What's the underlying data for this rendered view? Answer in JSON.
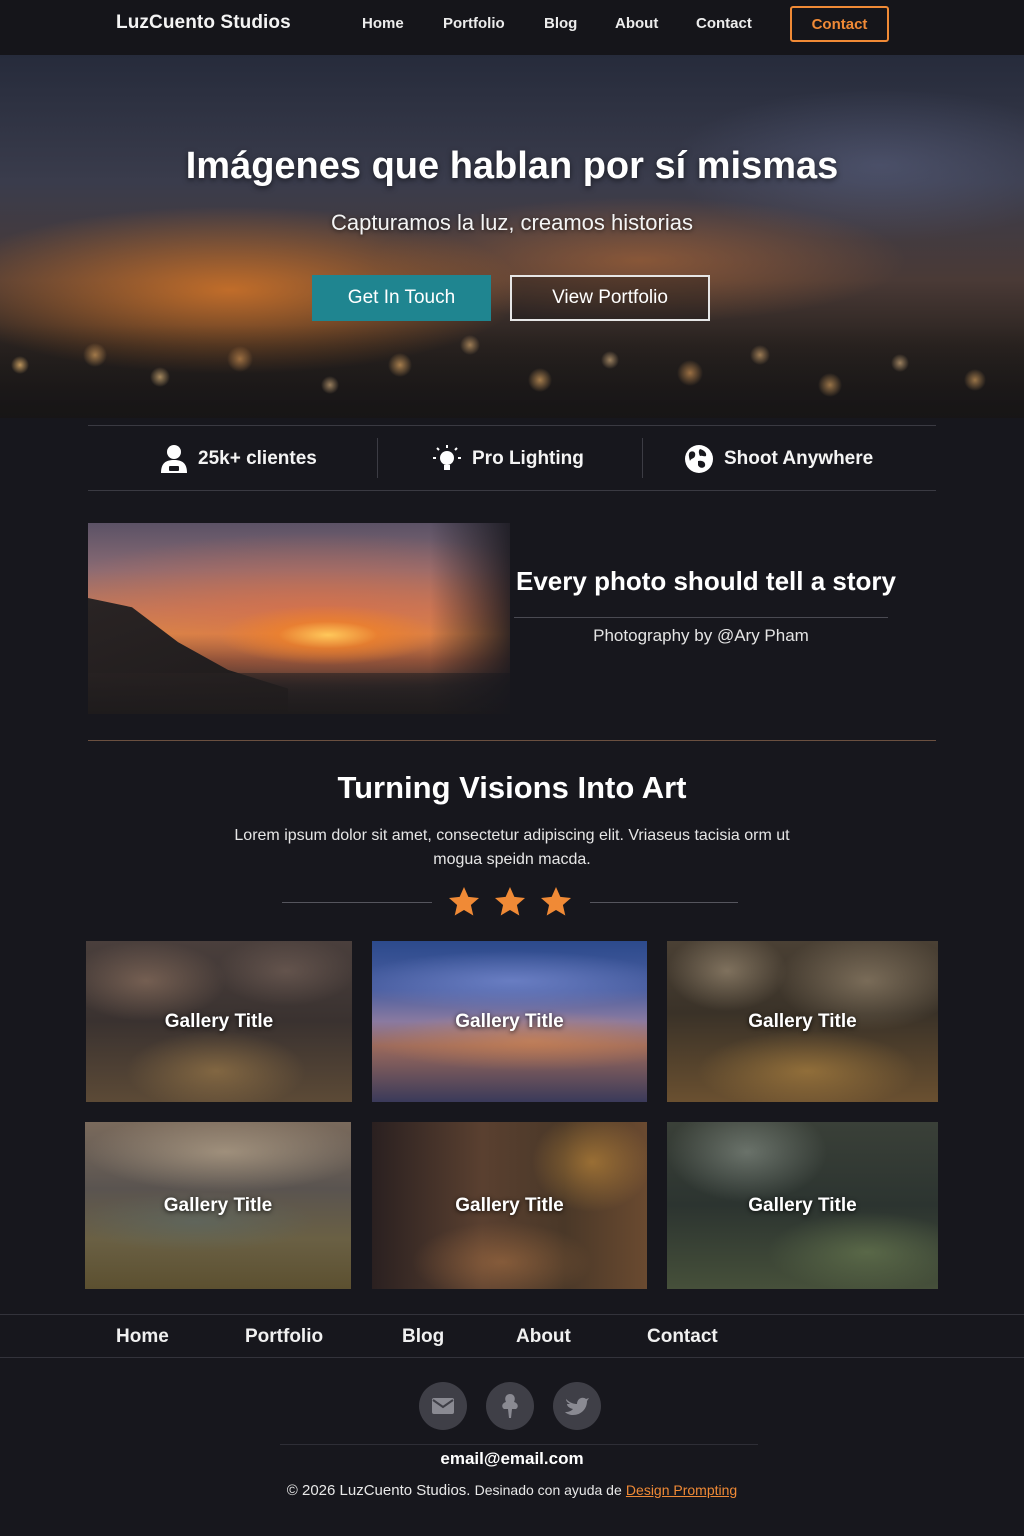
{
  "nav": {
    "brand": "LuzCuento Studios",
    "links": [
      "Home",
      "Portfolio",
      "Blog",
      "About",
      "Contact"
    ],
    "cta": "Contact",
    "accent": "#f08a36"
  },
  "hero": {
    "title": "Imágenes que hablan por sí mismas",
    "subtitle": "Capturamos la luz, creamos historias",
    "primary_button": "Get In Touch",
    "secondary_button": "View Portfolio",
    "primary_color": "#1f8590"
  },
  "features": [
    {
      "icon": "user-icon",
      "label": "25k+ clientes"
    },
    {
      "icon": "light-bulb-icon",
      "label": "Pro Lighting"
    },
    {
      "icon": "globe-icon",
      "label": "Shoot Anywhere"
    }
  ],
  "story": {
    "title": "Every photo should tell a story",
    "credit": "Photography by @Ary Pham"
  },
  "visions": {
    "title": "Turning Visions Into Art",
    "text": "Lorem ipsum dolor sit amet, consectetur adipiscing elit. Vriaseus tacisia orm ut mogua speidn macda.",
    "stars": 3
  },
  "gallery": [
    {
      "title": "Gallery Title"
    },
    {
      "title": "Gallery Title"
    },
    {
      "title": "Gallery Title"
    },
    {
      "title": "Gallery Title"
    },
    {
      "title": "Gallery Title"
    },
    {
      "title": "Gallery Title"
    }
  ],
  "footer": {
    "links": [
      "Home",
      "Portfolio",
      "Blog",
      "About",
      "Contact"
    ],
    "social": [
      "email-icon",
      "instagram-icon",
      "twitter-icon"
    ],
    "email": "email@email.com",
    "copyright": "© 2026 LuzCuento Studios.",
    "credit_prefix": "Desinado con ayuda de",
    "credit_link": "Design Prompting"
  }
}
